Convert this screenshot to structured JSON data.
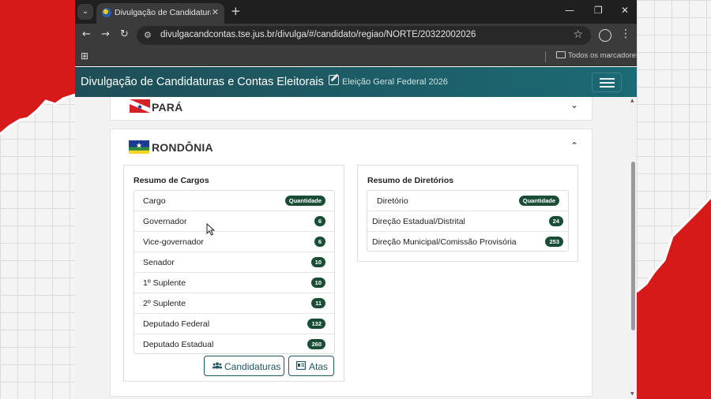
{
  "browser": {
    "tab_title": "Divulgação de Candidaturas e C",
    "tab_close": "✕",
    "new_tab": "+",
    "tab_menu": "⌄",
    "url": "divulgacandcontas.tse.jus.br/divulga/#/candidato/regiao/NORTE/20322002026",
    "bookmarks_label": "Todos os marcadores",
    "controls": {
      "minimize": "—",
      "maximize": "❐",
      "close": "✕"
    },
    "nav": {
      "back": "←",
      "forward": "→",
      "reload": "↻",
      "site_info": "⚙",
      "star": "☆",
      "menu": "⋮",
      "apps": "⊞"
    }
  },
  "app": {
    "title": "Divulgação de Candidaturas e Contas Eleitorais",
    "election": "Eleição Geral Federal 2026"
  },
  "states": [
    {
      "name": "PARÁ",
      "expanded": false,
      "chevron": "⌄"
    },
    {
      "name": "RONDÔNIA",
      "expanded": true,
      "chevron": "⌃",
      "cargos": {
        "title": "Resumo de Cargos",
        "header": {
          "label": "Cargo",
          "badge": "Quantidade"
        },
        "rows": [
          {
            "label": "Governador",
            "count": "6"
          },
          {
            "label": "Vice-governador",
            "count": "6"
          },
          {
            "label": "Senador",
            "count": "10"
          },
          {
            "label": "1º Suplente",
            "count": "10"
          },
          {
            "label": "2º Suplente",
            "count": "11"
          },
          {
            "label": "Deputado Federal",
            "count": "132"
          },
          {
            "label": "Deputado Estadual",
            "count": "260"
          }
        ]
      },
      "diretorios": {
        "title": "Resumo de Diretórios",
        "header": {
          "label": "Diretório",
          "badge": "Quantidade"
        },
        "rows": [
          {
            "label": "Direção Estadual/Distrital",
            "count": "24"
          },
          {
            "label": "Direção Municipal/Comissão Provisória",
            "count": "253"
          }
        ]
      },
      "buttons": {
        "candidaturas": "Candidaturas",
        "atas": "Atas"
      }
    }
  ],
  "colors": {
    "header_start": "#1f4e57",
    "header_end": "#1b6a74",
    "badge": "#1a4d36",
    "button": "#1e5662"
  },
  "icons": [
    "site-settings-icon",
    "star-icon",
    "account-icon",
    "edit-icon",
    "hamburger-icon",
    "users-icon",
    "id-card-icon",
    "folder-icon",
    "apps-icon"
  ]
}
